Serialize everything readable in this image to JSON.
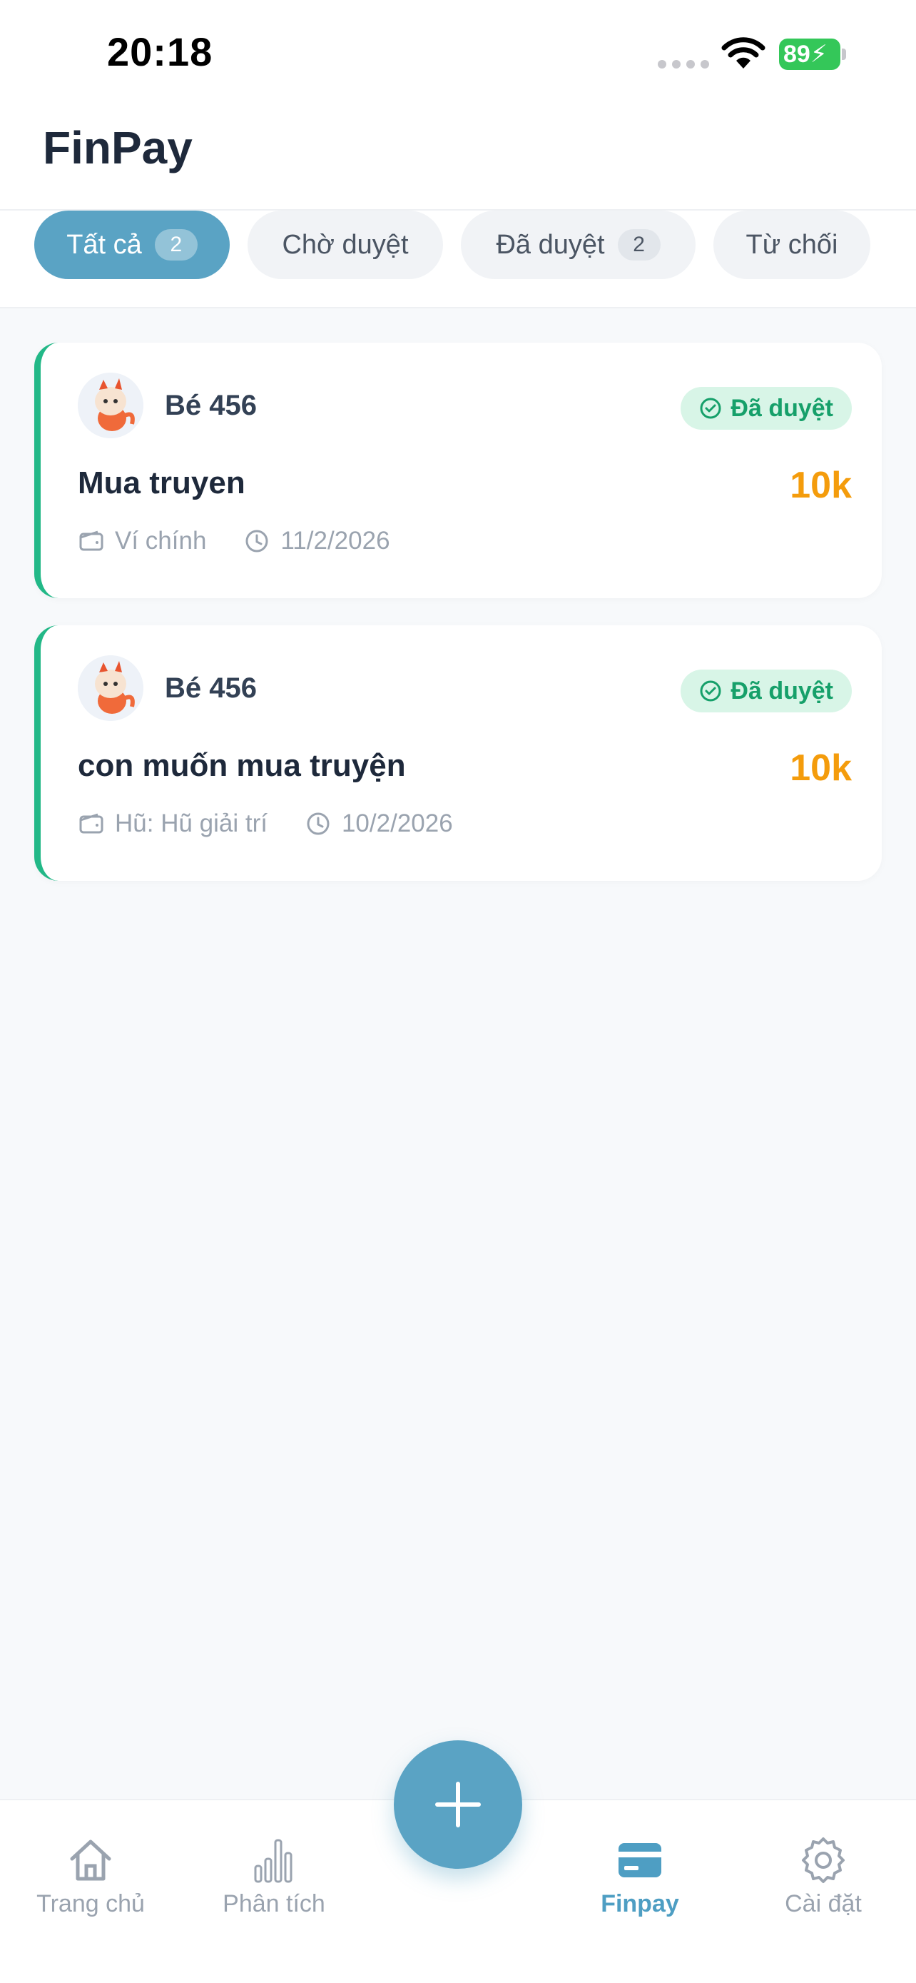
{
  "status_bar": {
    "time": "20:18",
    "battery": "89"
  },
  "header": {
    "title": "FinPay"
  },
  "filters": [
    {
      "label": "Tất cả",
      "count": "2",
      "active": true
    },
    {
      "label": "Chờ duyệt",
      "count": null,
      "active": false
    },
    {
      "label": "Đã duyệt",
      "count": "2",
      "active": false
    },
    {
      "label": "Từ chối",
      "count": null,
      "active": false
    }
  ],
  "requests": [
    {
      "child_name": "Bé 456",
      "status": "Đã duyệt",
      "title": "Mua truyen",
      "amount": "10k",
      "wallet": "Ví chính",
      "date": "11/2/2026"
    },
    {
      "child_name": "Bé 456",
      "status": "Đã duyệt",
      "title": "con muốn mua truyện",
      "amount": "10k",
      "wallet": "Hũ: Hũ giải trí",
      "date": "10/2/2026"
    }
  ],
  "nav": {
    "home": "Trang chủ",
    "analytics": "Phân tích",
    "finpay": "Finpay",
    "settings": "Cài đặt"
  },
  "colors": {
    "accent": "#5aa3c4",
    "approved_border": "#22b887",
    "approved_badge_bg": "#d8f5e7",
    "approved_badge_text": "#16a06a",
    "amount": "#f49c0c"
  }
}
